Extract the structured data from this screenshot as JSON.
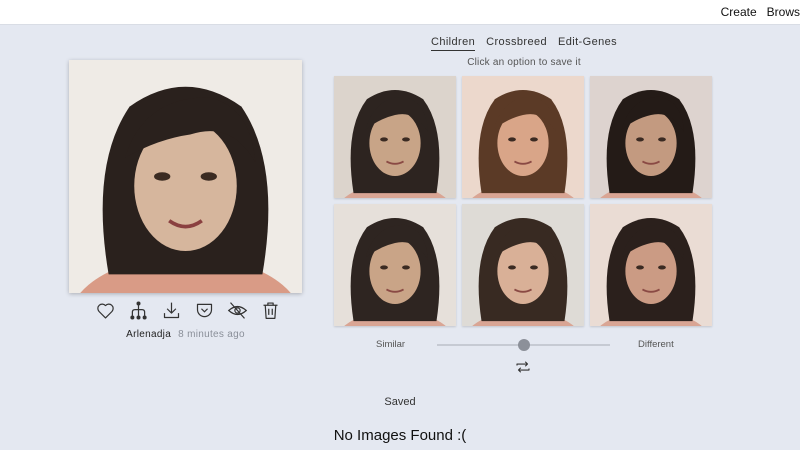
{
  "topnav": {
    "create": "Create",
    "browse": "Brows"
  },
  "main_image": {
    "author": "Arlenadja",
    "time": "8 minutes ago"
  },
  "actions": [
    {
      "icon": "heart-icon"
    },
    {
      "icon": "family-tree-icon"
    },
    {
      "icon": "download-icon"
    },
    {
      "icon": "pocket-save-icon"
    },
    {
      "icon": "eye-off-icon"
    },
    {
      "icon": "trash-icon"
    }
  ],
  "tabs": [
    {
      "label": "Children",
      "active": true
    },
    {
      "label": "Crossbreed",
      "active": false
    },
    {
      "label": "Edit-Genes",
      "active": false
    }
  ],
  "hint": "Click an option to save it",
  "options": [
    {
      "skin": "#c8a487",
      "hair": "#2d2420",
      "bg": "#dcd4cc"
    },
    {
      "skin": "#d9a588",
      "hair": "#5b3a26",
      "bg": "#ecd8cc"
    },
    {
      "skin": "#c39a80",
      "hair": "#241b17",
      "bg": "#ddd3cf"
    },
    {
      "skin": "#c9a487",
      "hair": "#2e2521",
      "bg": "#e6e0da"
    },
    {
      "skin": "#d9b097",
      "hair": "#382a22",
      "bg": "#dedbd6"
    },
    {
      "skin": "#cb9b84",
      "hair": "#2b201c",
      "bg": "#eadcd4"
    }
  ],
  "similarity": {
    "left": "Similar",
    "right": "Different",
    "value": 0.5
  },
  "saved_label": "Saved",
  "empty_message": "No Images Found :("
}
